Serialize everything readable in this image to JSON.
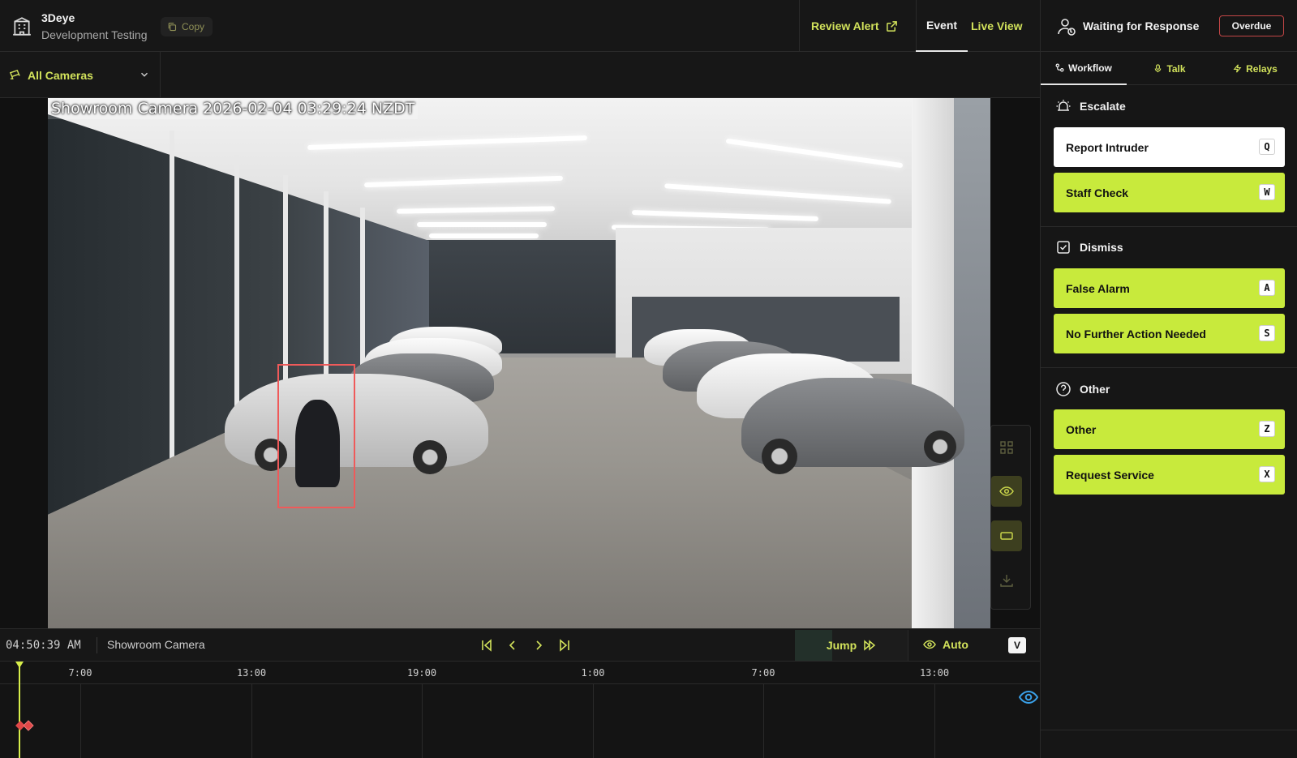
{
  "header": {
    "brand_name": "3Deye",
    "brand_sub": "Development Testing",
    "copy_label": "Copy",
    "review_alert_label": "Review Alert",
    "tabs": [
      {
        "label": "Event",
        "active": true
      },
      {
        "label": "Live View",
        "active": false
      }
    ]
  },
  "camera_select": {
    "label": "All Cameras"
  },
  "video": {
    "overlay_text": "Showroom Camera 2026-02-04 03:29:24 NZDT",
    "detection_color": "#ef5a5a"
  },
  "video_controls": [
    "grid-icon",
    "eye-icon",
    "rectangle-icon",
    "download-icon"
  ],
  "player": {
    "clock": "04:50:39 AM",
    "camera_name": "Showroom Camera",
    "nav": [
      "skip-start-icon",
      "prev-icon",
      "next-icon",
      "skip-end-icon"
    ],
    "jump_label": "Jump",
    "auto_label": "Auto",
    "shortcut_key": "V"
  },
  "timeline": {
    "ticks": [
      "7:00",
      "13:00",
      "19:00",
      "1:00",
      "7:00",
      "13:00"
    ]
  },
  "right_panel": {
    "status_title": "Waiting for Response",
    "overdue_label": "Overdue",
    "tabs": [
      {
        "label": "Workflow",
        "icon": "workflow-icon",
        "active": true
      },
      {
        "label": "Talk",
        "icon": "mic-icon",
        "active": false
      },
      {
        "label": "Relays",
        "icon": "bolt-icon",
        "active": false
      }
    ],
    "sections": [
      {
        "title": "Escalate",
        "icon": "alarm-icon",
        "actions": [
          {
            "label": "Report Intruder",
            "key": "Q",
            "style": "white"
          },
          {
            "label": "Staff Check",
            "key": "W",
            "style": "lime"
          }
        ]
      },
      {
        "title": "Dismiss",
        "icon": "check-square-icon",
        "actions": [
          {
            "label": "False Alarm",
            "key": "A",
            "style": "lime"
          },
          {
            "label": "No Further Action Needed",
            "key": "S",
            "style": "lime"
          }
        ]
      },
      {
        "title": "Other",
        "icon": "question-circle-icon",
        "actions": [
          {
            "label": "Other",
            "key": "Z",
            "style": "lime"
          },
          {
            "label": "Request Service",
            "key": "X",
            "style": "lime"
          }
        ]
      }
    ]
  },
  "colors": {
    "accent": "#d2e25b",
    "action_lime": "#c8ea3c",
    "overdue_border": "#c24646",
    "timeline_eye": "#3aa0e8"
  }
}
